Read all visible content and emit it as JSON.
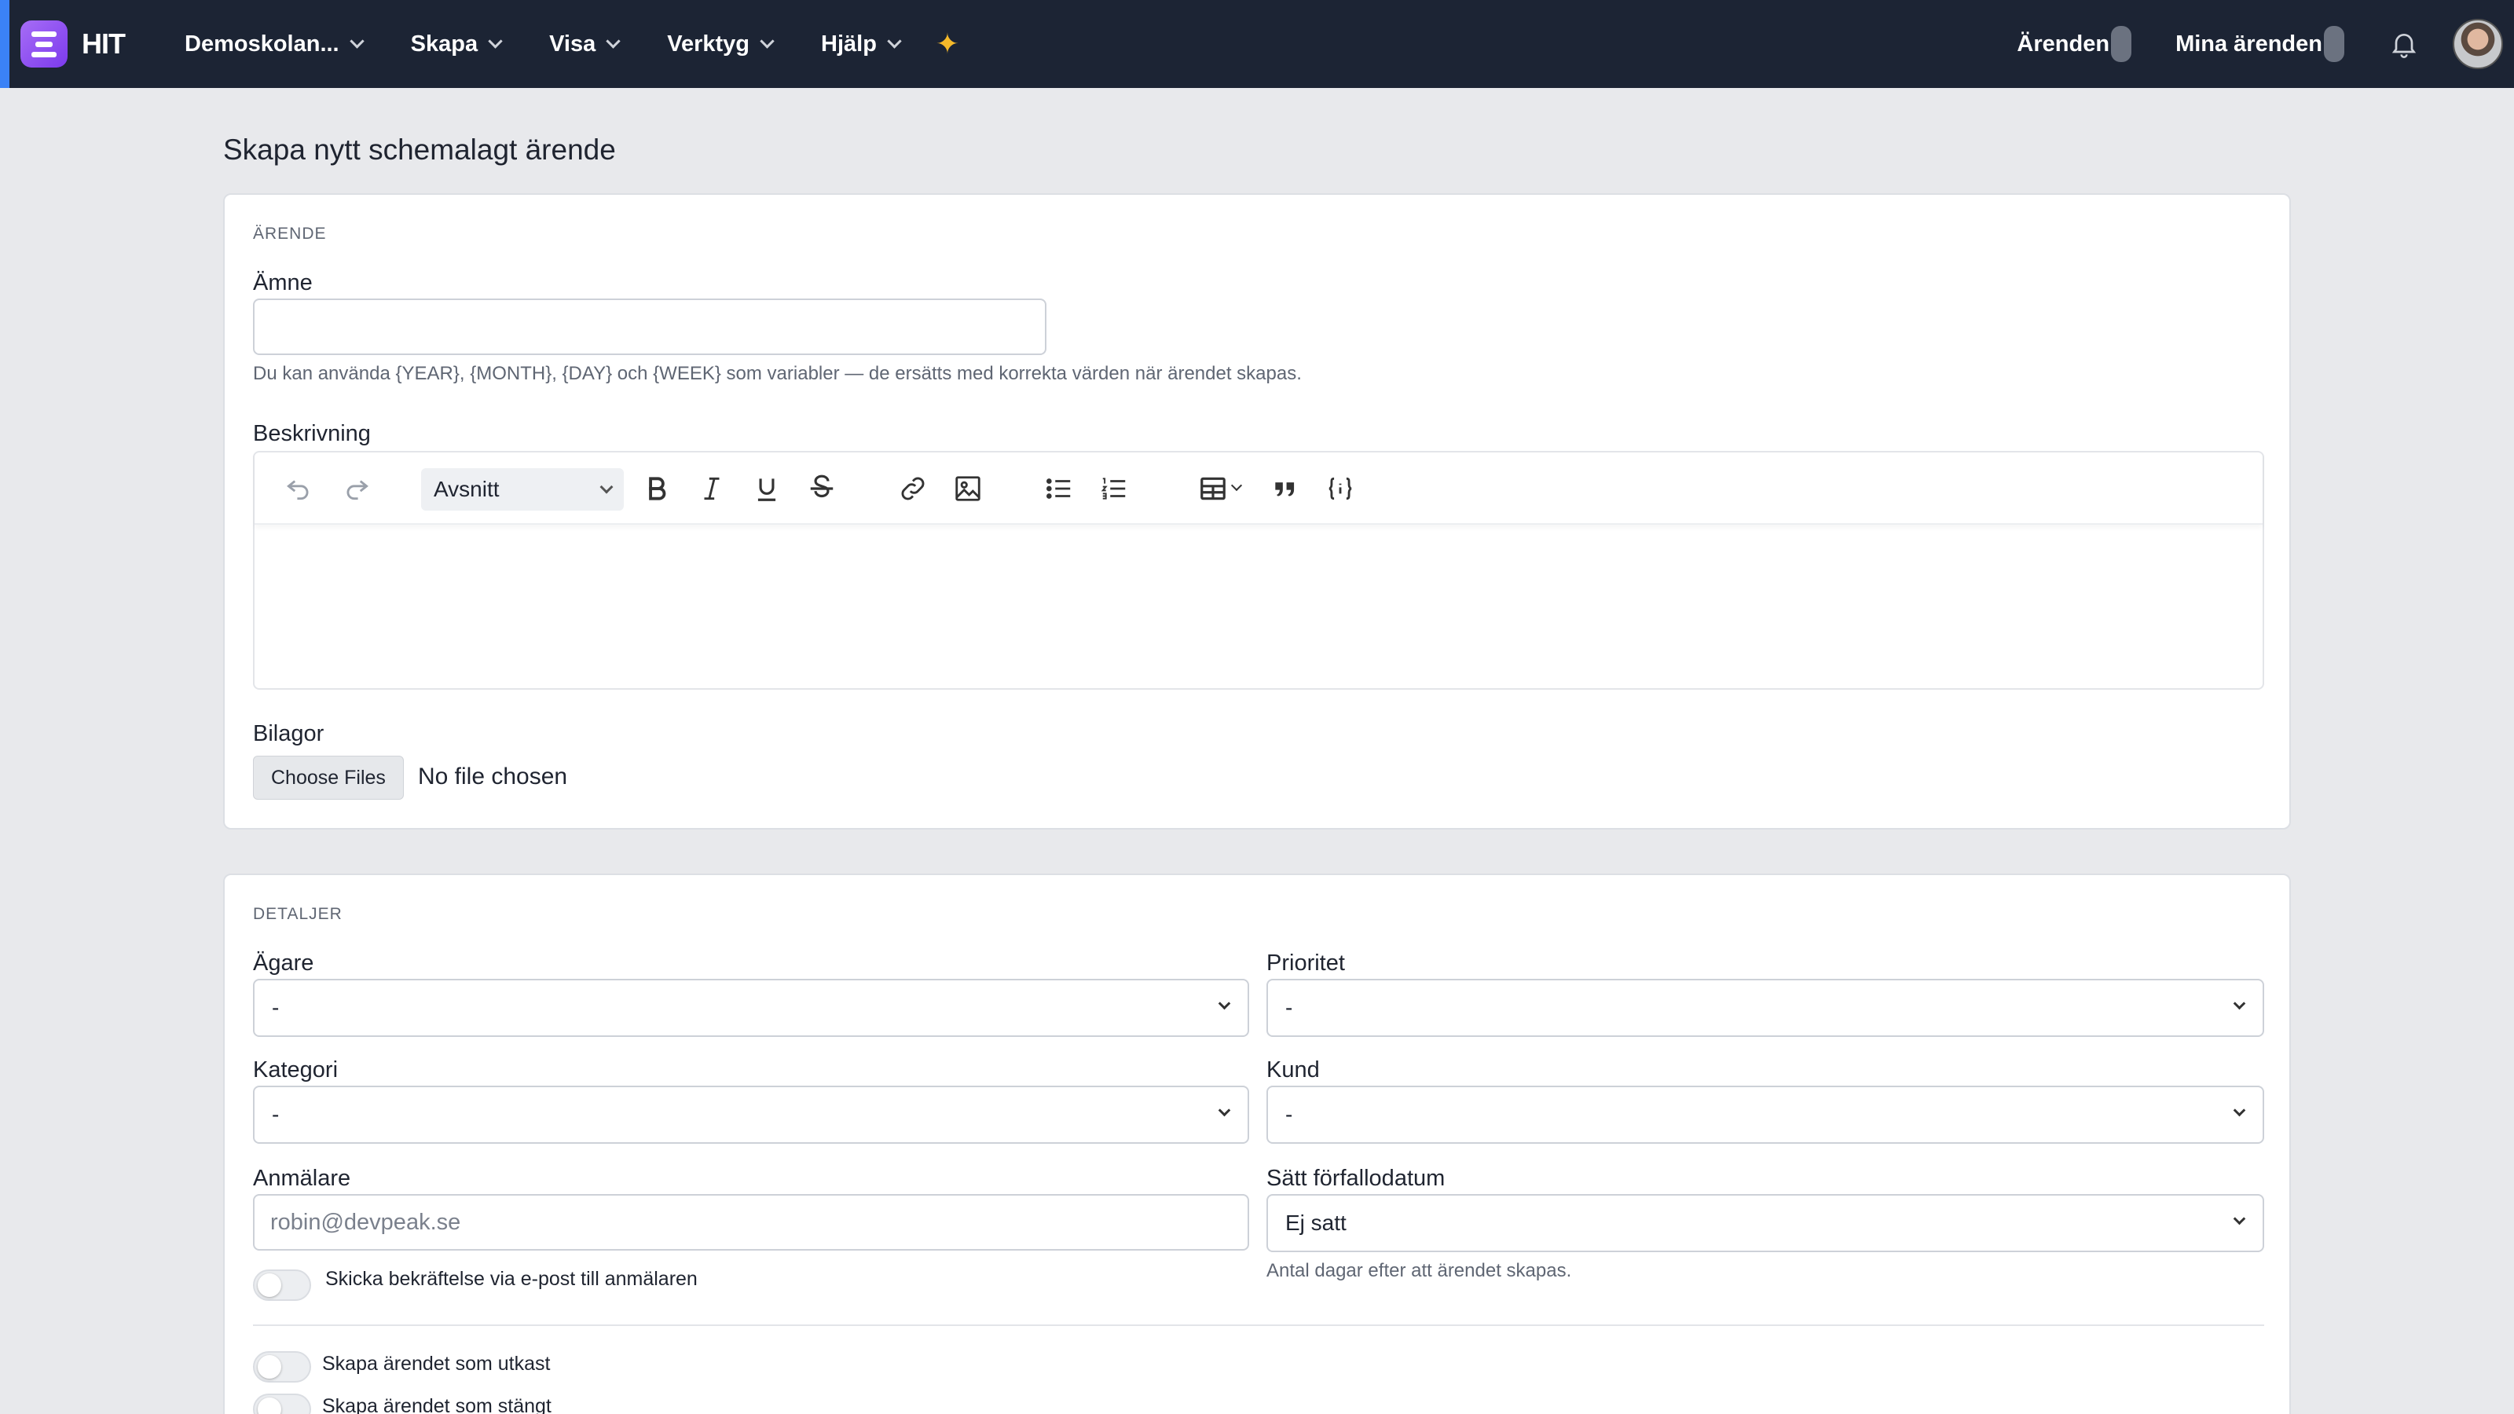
{
  "app": {
    "brand": "HIT",
    "menu": [
      {
        "label": "Demoskolan..."
      },
      {
        "label": "Skapa"
      },
      {
        "label": "Visa"
      },
      {
        "label": "Verktyg"
      },
      {
        "label": "Hjälp"
      }
    ],
    "right": {
      "tickets_label": "Ärenden",
      "my_tickets_label": "Mina ärenden"
    },
    "icons": [
      "sparkle-icon",
      "bell-icon",
      "avatar"
    ],
    "colors": {
      "navbar": "#1c2434",
      "accent": "#7c3aed",
      "sparkle": "#f5b92a"
    }
  },
  "page": {
    "title": "Skapa nytt schemalagt ärende",
    "ticket": {
      "section": "ÄRENDE",
      "subject_label": "Ämne",
      "subject_value": "",
      "subject_help": "Du kan använda {YEAR}, {MONTH}, {DAY} och {WEEK} som variabler — de ersätts med korrekta värden när ärendet skapas.",
      "description_label": "Beskrivning",
      "editor": {
        "paragraph_style": "Avsnitt",
        "tools": [
          "undo-icon",
          "redo-icon",
          "bold-icon",
          "italic-icon",
          "underline-icon",
          "strikethrough-icon",
          "link-icon",
          "image-icon",
          "bullet-list-icon",
          "numbered-list-icon",
          "table-icon",
          "quote-icon",
          "variable-icon"
        ]
      },
      "attachments_label": "Bilagor",
      "choose_files": "Choose Files",
      "no_file": "No file chosen"
    },
    "details": {
      "section": "DETALJER",
      "owner_label": "Ägare",
      "owner_value": "-",
      "priority_label": "Prioritet",
      "priority_value": "-",
      "category_label": "Kategori",
      "category_value": "-",
      "customer_label": "Kund",
      "customer_value": "-",
      "reporter_label": "Anmälare",
      "reporter_placeholder": "robin@devpeak.se",
      "due_label": "Sätt förfallodatum",
      "due_value": "Ej satt",
      "due_help": "Antal dagar efter att ärendet skapas.",
      "confirm_email_label": "Skicka bekräftelse via e-post till anmälaren",
      "draft_label": "Skapa ärendet som utkast",
      "closed_label": "Skapa ärendet som stängt"
    }
  }
}
